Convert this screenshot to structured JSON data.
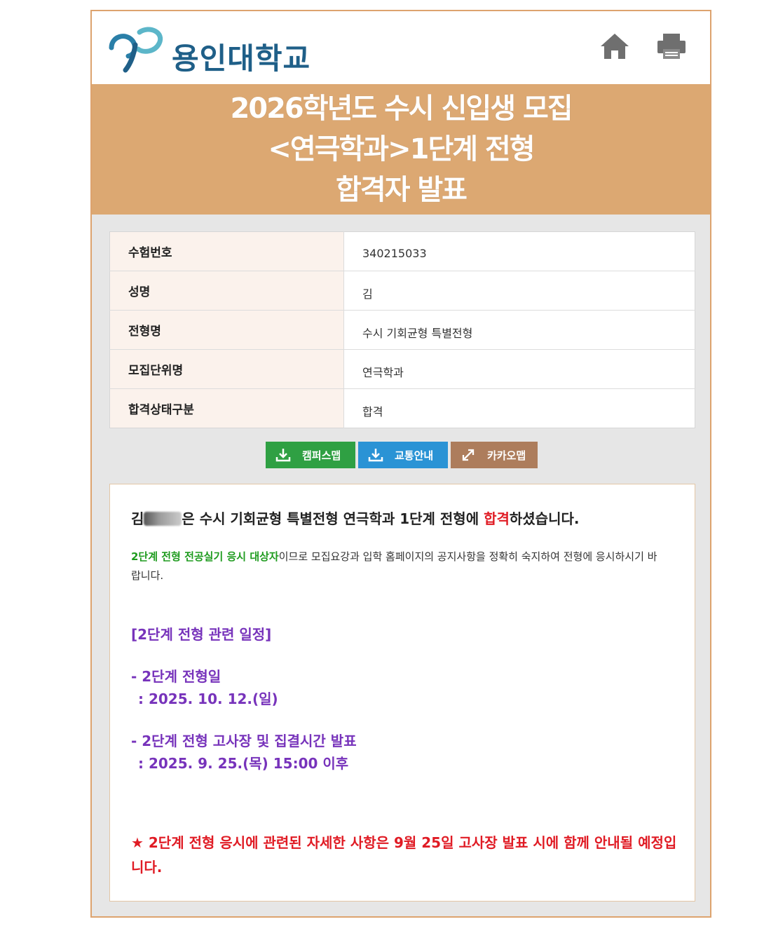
{
  "header": {
    "university_name": "용인대학교",
    "home_icon": "home-icon",
    "print_icon": "printer-icon"
  },
  "banner": {
    "line1": "2026학년도 수시 신입생 모집",
    "line2": "<연극학과>1단계 전형",
    "line3": "합격자 발표"
  },
  "info": {
    "rows": [
      {
        "label": "수험번호",
        "value": "340215033"
      },
      {
        "label": "성명",
        "value": "김"
      },
      {
        "label": "전형명",
        "value": "수시 기회균형 특별전형"
      },
      {
        "label": "모집단위명",
        "value": "연극학과"
      },
      {
        "label": "합격상태구분",
        "value": "합격"
      }
    ]
  },
  "buttons": {
    "campus_map": "캠퍼스맵",
    "transport": "교통안내",
    "kakao_map": "카카오맵"
  },
  "notice": {
    "name_prefix": "김",
    "line1_mid": "은 수시 기회균형 특별전형 연극학과 1단계 전형에 ",
    "line1_pass": "합격",
    "line1_end": "하셨습니다.",
    "para_green": "2단계 전형 전공실기 응시 대상자",
    "para_rest": "이므로 모집요강과 입학 홈페이지의 공지사항을 정확히 숙지하여 전형에 응시하시기 바랍니다.",
    "schedule_heading": "[2단계 전형 관련 일정]",
    "item1_title": "- 2단계 전형일",
    "item1_date": ": 2025. 10. 12.(일)",
    "item2_title": "- 2단계 전형 고사장 및 집결시간 발표",
    "item2_date": ": 2025. 9. 25.(목) 15:00 이후",
    "final_note": "★ 2단계 전형 응시에 관련된 자세한 사항은 9월 25일 고사장 발표 시에 함께 안내될 예정입니다."
  },
  "colors": {
    "banner": "#dca872",
    "campus_btn": "#2fa043",
    "transport_btn": "#2a93d5",
    "kakao_btn": "#ad7d5c",
    "highlight_red": "#e01b24",
    "green_text": "#1e9b1e",
    "purple_text": "#7733bb"
  }
}
